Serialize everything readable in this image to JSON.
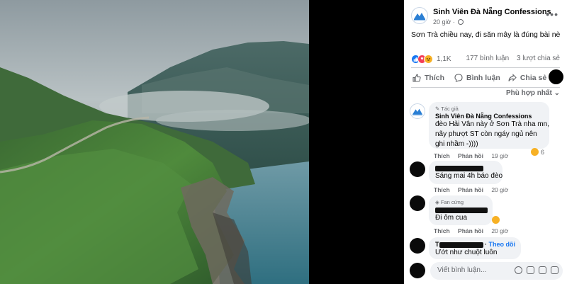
{
  "post": {
    "page_name": "Sinh Viên Đà Nẵng Confessions",
    "time": "20 giờ",
    "caption": "Sơn Trà chiều nay, đi săn mây là đúng bài nè",
    "reaction_count": "1,1K",
    "comment_count": "177 bình luận",
    "share_count": "3 lượt chia sẻ",
    "actions": {
      "like": "Thích",
      "comment": "Bình luận",
      "share": "Chia sẻ"
    },
    "sort_label": "Phù hợp nhất"
  },
  "comments": [
    {
      "badge": "Tác giả",
      "name": "Sinh Viên Đà Nẵng Confessions",
      "lines": [
        "đèo Hải Vân này ở Sơn Trà nha mn,",
        "nãy phượt ST còn ngáy ngủ nên",
        "ghi nhầm -))))"
      ],
      "like_label": "Thích",
      "reply_label": "Phản hồi",
      "time": "19 giờ",
      "reaction_count": "6"
    },
    {
      "text": "Sáng mai 4h báo đèo",
      "like_label": "Thích",
      "reply_label": "Phản hồi",
      "time": "20 giờ"
    },
    {
      "badge": "Fan cứng",
      "text": "Đi ôm cua",
      "like_label": "Thích",
      "reply_label": "Phản hồi",
      "time": "20 giờ"
    },
    {
      "name_initial": "T",
      "follow_label": "Theo dõi",
      "text": "Ướt như chuột luôn"
    }
  ],
  "compose": {
    "placeholder": "Viết bình luận..."
  },
  "colors": {
    "accent": "#1877f2",
    "bubble": "#f0f2f5",
    "muted": "#65676b"
  }
}
